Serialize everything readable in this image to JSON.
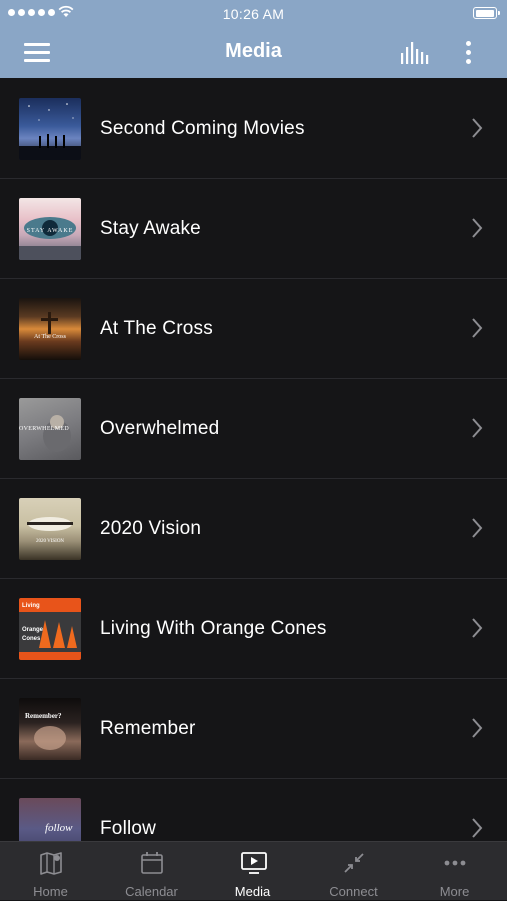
{
  "status_bar": {
    "time": "10:26 AM"
  },
  "nav": {
    "title": "Media"
  },
  "media_items": [
    {
      "title": "Second Coming Movies"
    },
    {
      "title": "Stay Awake",
      "thumb_text": "STAY AWAKE"
    },
    {
      "title": "At The Cross",
      "thumb_text": "At The Cross"
    },
    {
      "title": "Overwhelmed",
      "thumb_text": "OVERWHELMED"
    },
    {
      "title": "2020 Vision",
      "thumb_text": "2020 VISION"
    },
    {
      "title": "Living With Orange Cones",
      "thumb_text_1": "Living",
      "thumb_text_2": "Orange",
      "thumb_text_3": "Cones"
    },
    {
      "title": "Remember",
      "thumb_text": "Remember?"
    },
    {
      "title": "Follow",
      "thumb_text": "follow"
    }
  ],
  "tabs": [
    {
      "label": "Home",
      "icon": "map-icon",
      "active": false
    },
    {
      "label": "Calendar",
      "icon": "calendar-icon",
      "active": false
    },
    {
      "label": "Media",
      "icon": "media-play-icon",
      "active": true
    },
    {
      "label": "Connect",
      "icon": "connect-arrows-icon",
      "active": false
    },
    {
      "label": "More",
      "icon": "more-dots-icon",
      "active": false
    }
  ],
  "colors": {
    "header": "#8aa6c6",
    "list_bg": "#151517",
    "tab_bar": "#2c2c2f",
    "tab_inactive": "#8d8d92"
  }
}
